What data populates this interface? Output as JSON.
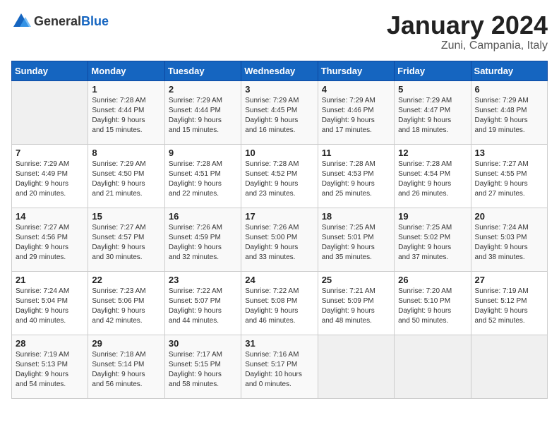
{
  "logo": {
    "text_general": "General",
    "text_blue": "Blue"
  },
  "title": {
    "month": "January 2024",
    "location": "Zuni, Campania, Italy"
  },
  "days_of_week": [
    "Sunday",
    "Monday",
    "Tuesday",
    "Wednesday",
    "Thursday",
    "Friday",
    "Saturday"
  ],
  "weeks": [
    [
      {
        "day": "",
        "info": ""
      },
      {
        "day": "1",
        "info": "Sunrise: 7:28 AM\nSunset: 4:44 PM\nDaylight: 9 hours\nand 15 minutes."
      },
      {
        "day": "2",
        "info": "Sunrise: 7:29 AM\nSunset: 4:44 PM\nDaylight: 9 hours\nand 15 minutes."
      },
      {
        "day": "3",
        "info": "Sunrise: 7:29 AM\nSunset: 4:45 PM\nDaylight: 9 hours\nand 16 minutes."
      },
      {
        "day": "4",
        "info": "Sunrise: 7:29 AM\nSunset: 4:46 PM\nDaylight: 9 hours\nand 17 minutes."
      },
      {
        "day": "5",
        "info": "Sunrise: 7:29 AM\nSunset: 4:47 PM\nDaylight: 9 hours\nand 18 minutes."
      },
      {
        "day": "6",
        "info": "Sunrise: 7:29 AM\nSunset: 4:48 PM\nDaylight: 9 hours\nand 19 minutes."
      }
    ],
    [
      {
        "day": "7",
        "info": "Sunrise: 7:29 AM\nSunset: 4:49 PM\nDaylight: 9 hours\nand 20 minutes."
      },
      {
        "day": "8",
        "info": "Sunrise: 7:29 AM\nSunset: 4:50 PM\nDaylight: 9 hours\nand 21 minutes."
      },
      {
        "day": "9",
        "info": "Sunrise: 7:28 AM\nSunset: 4:51 PM\nDaylight: 9 hours\nand 22 minutes."
      },
      {
        "day": "10",
        "info": "Sunrise: 7:28 AM\nSunset: 4:52 PM\nDaylight: 9 hours\nand 23 minutes."
      },
      {
        "day": "11",
        "info": "Sunrise: 7:28 AM\nSunset: 4:53 PM\nDaylight: 9 hours\nand 25 minutes."
      },
      {
        "day": "12",
        "info": "Sunrise: 7:28 AM\nSunset: 4:54 PM\nDaylight: 9 hours\nand 26 minutes."
      },
      {
        "day": "13",
        "info": "Sunrise: 7:27 AM\nSunset: 4:55 PM\nDaylight: 9 hours\nand 27 minutes."
      }
    ],
    [
      {
        "day": "14",
        "info": "Sunrise: 7:27 AM\nSunset: 4:56 PM\nDaylight: 9 hours\nand 29 minutes."
      },
      {
        "day": "15",
        "info": "Sunrise: 7:27 AM\nSunset: 4:57 PM\nDaylight: 9 hours\nand 30 minutes."
      },
      {
        "day": "16",
        "info": "Sunrise: 7:26 AM\nSunset: 4:59 PM\nDaylight: 9 hours\nand 32 minutes."
      },
      {
        "day": "17",
        "info": "Sunrise: 7:26 AM\nSunset: 5:00 PM\nDaylight: 9 hours\nand 33 minutes."
      },
      {
        "day": "18",
        "info": "Sunrise: 7:25 AM\nSunset: 5:01 PM\nDaylight: 9 hours\nand 35 minutes."
      },
      {
        "day": "19",
        "info": "Sunrise: 7:25 AM\nSunset: 5:02 PM\nDaylight: 9 hours\nand 37 minutes."
      },
      {
        "day": "20",
        "info": "Sunrise: 7:24 AM\nSunset: 5:03 PM\nDaylight: 9 hours\nand 38 minutes."
      }
    ],
    [
      {
        "day": "21",
        "info": "Sunrise: 7:24 AM\nSunset: 5:04 PM\nDaylight: 9 hours\nand 40 minutes."
      },
      {
        "day": "22",
        "info": "Sunrise: 7:23 AM\nSunset: 5:06 PM\nDaylight: 9 hours\nand 42 minutes."
      },
      {
        "day": "23",
        "info": "Sunrise: 7:22 AM\nSunset: 5:07 PM\nDaylight: 9 hours\nand 44 minutes."
      },
      {
        "day": "24",
        "info": "Sunrise: 7:22 AM\nSunset: 5:08 PM\nDaylight: 9 hours\nand 46 minutes."
      },
      {
        "day": "25",
        "info": "Sunrise: 7:21 AM\nSunset: 5:09 PM\nDaylight: 9 hours\nand 48 minutes."
      },
      {
        "day": "26",
        "info": "Sunrise: 7:20 AM\nSunset: 5:10 PM\nDaylight: 9 hours\nand 50 minutes."
      },
      {
        "day": "27",
        "info": "Sunrise: 7:19 AM\nSunset: 5:12 PM\nDaylight: 9 hours\nand 52 minutes."
      }
    ],
    [
      {
        "day": "28",
        "info": "Sunrise: 7:19 AM\nSunset: 5:13 PM\nDaylight: 9 hours\nand 54 minutes."
      },
      {
        "day": "29",
        "info": "Sunrise: 7:18 AM\nSunset: 5:14 PM\nDaylight: 9 hours\nand 56 minutes."
      },
      {
        "day": "30",
        "info": "Sunrise: 7:17 AM\nSunset: 5:15 PM\nDaylight: 9 hours\nand 58 minutes."
      },
      {
        "day": "31",
        "info": "Sunrise: 7:16 AM\nSunset: 5:17 PM\nDaylight: 10 hours\nand 0 minutes."
      },
      {
        "day": "",
        "info": ""
      },
      {
        "day": "",
        "info": ""
      },
      {
        "day": "",
        "info": ""
      }
    ]
  ]
}
